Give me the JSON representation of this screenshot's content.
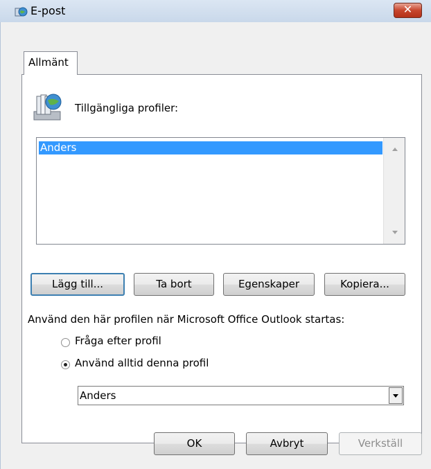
{
  "window": {
    "title": "E-post",
    "close_label": "✕",
    "icon": "mail-globe-icon"
  },
  "tabs": [
    {
      "label": "Allmänt",
      "active": true
    }
  ],
  "profiles": {
    "icon": "profiles-icon",
    "label": "Tillgängliga profiler:",
    "items": [
      {
        "label": "Anders",
        "selected": true
      }
    ]
  },
  "buttons": {
    "add": "Lägg till...",
    "remove": "Ta bort",
    "properties": "Egenskaper",
    "copy": "Kopiera..."
  },
  "startup": {
    "label": "Använd den här profilen när Microsoft Office Outlook startas:",
    "options": [
      {
        "label": "Fråga efter profil",
        "checked": false
      },
      {
        "label": "Använd alltid denna profil",
        "checked": true
      }
    ],
    "selected_profile": "Anders"
  },
  "footer": {
    "ok": "OK",
    "cancel": "Avbryt",
    "apply": "Verkställ",
    "apply_disabled": true
  },
  "colors": {
    "selection": "#3399ff",
    "close_button": "#c7452d",
    "default_button_border": "#3c7fb1"
  }
}
